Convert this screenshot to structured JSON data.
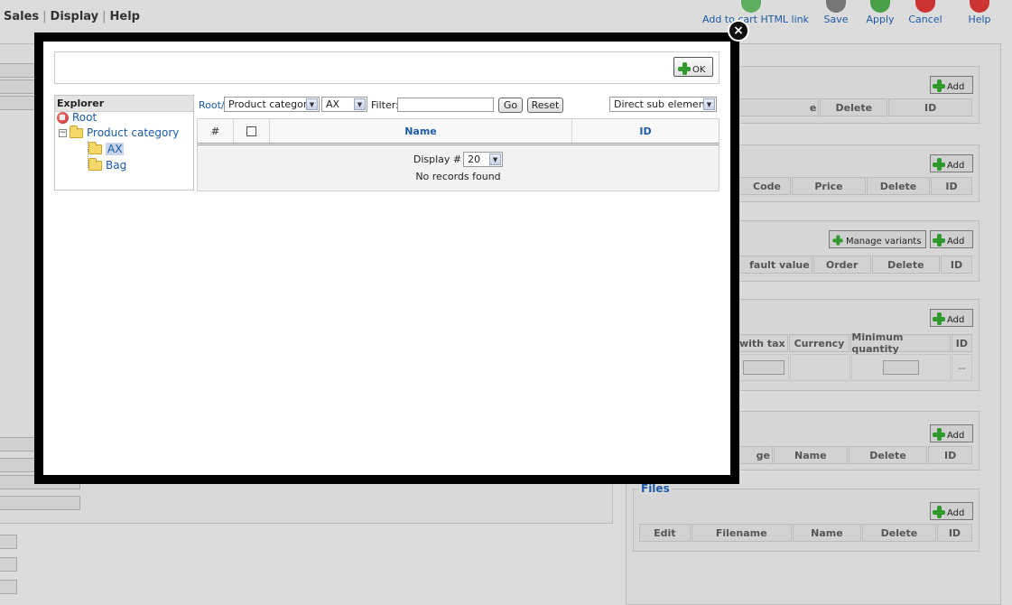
{
  "menubar": {
    "items": [
      "Sales",
      "Display",
      "Help"
    ],
    "tools": [
      {
        "label": "Add to cart HTML link",
        "icon": "cart-link-icon",
        "color": "#3a9a3a"
      },
      {
        "label": "Save",
        "icon": "save-icon",
        "color": "#444444"
      },
      {
        "label": "Apply",
        "icon": "apply-icon",
        "color": "#2e9a2e"
      },
      {
        "label": "Cancel",
        "icon": "cancel-icon",
        "color": "#cc2222"
      },
      {
        "label": "Help",
        "icon": "help-icon",
        "color": "#cc2222"
      }
    ]
  },
  "right_panel": {
    "sections": [
      {
        "title": "",
        "add_label": "Add",
        "columns": [
          "e",
          "Delete",
          "ID"
        ]
      },
      {
        "title": "",
        "add_label": "Add",
        "columns": [
          "Code",
          "Price",
          "Delete",
          "ID"
        ]
      },
      {
        "title": "",
        "add_label": "Add",
        "manage_label": "Manage variants",
        "columns": [
          "fault value",
          "Order",
          "Delete",
          "ID"
        ]
      },
      {
        "title": "",
        "add_label": "Add",
        "columns": [
          "e with tax",
          "Currency",
          "Minimum quantity",
          "ID"
        ],
        "row_value": "--"
      },
      {
        "title": "",
        "add_label": "Add",
        "columns": [
          "ge",
          "Name",
          "Delete",
          "ID"
        ]
      },
      {
        "title": "Files",
        "add_label": "Add",
        "columns": [
          "Edit",
          "Filename",
          "Name",
          "Delete",
          "ID"
        ]
      }
    ]
  },
  "modal": {
    "close_symbol": "×",
    "ok_label": "OK",
    "explorer": {
      "title": "Explorer",
      "root": "Root",
      "category": "Product category",
      "children": [
        "AX",
        "Bag"
      ],
      "expander": "−"
    },
    "toolbar": {
      "breadcrumb": "Root/",
      "category_select": "Product category",
      "sub_select": "AX",
      "filter_label": "Filter:",
      "filter_value": "",
      "go_label": "Go",
      "reset_label": "Reset",
      "scope_select": "Direct sub elements",
      "arrow": "▼"
    },
    "grid": {
      "columns": {
        "num": "#",
        "name": "Name",
        "id": "ID"
      },
      "display_label": "Display #",
      "display_value": "20",
      "empty_text": "No records found"
    }
  }
}
